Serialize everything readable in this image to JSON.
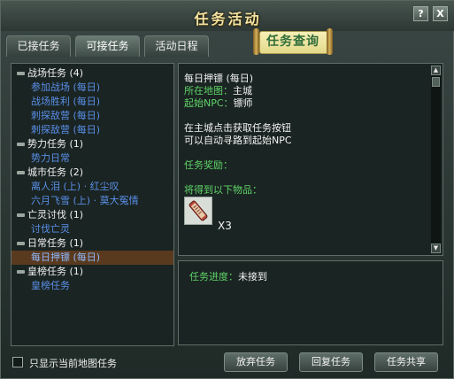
{
  "window": {
    "title": "任务活动",
    "help_label": "?",
    "close_label": "X"
  },
  "tabs": [
    {
      "label": "已接任务"
    },
    {
      "label": "可接任务"
    },
    {
      "label": "活动日程"
    }
  ],
  "badge": {
    "label": "任务查询"
  },
  "quest_list": [
    {
      "kind": "category",
      "label": "战场任务 (4)"
    },
    {
      "kind": "quest",
      "label": "参加战场 (每日)"
    },
    {
      "kind": "quest",
      "label": "战场胜利 (每日)"
    },
    {
      "kind": "quest",
      "label": "刺探敌营 (每日)"
    },
    {
      "kind": "quest",
      "label": "刺探敌营 (每日)"
    },
    {
      "kind": "category",
      "label": "势力任务 (1)"
    },
    {
      "kind": "quest",
      "label": "势力日常"
    },
    {
      "kind": "category",
      "label": "城市任务 (2)"
    },
    {
      "kind": "quest",
      "label": "离人泪 (上) · 红尘叹"
    },
    {
      "kind": "quest",
      "label": "六月飞雪 (上) · 莫大冤情"
    },
    {
      "kind": "category",
      "label": "亡灵讨伐 (1)"
    },
    {
      "kind": "quest",
      "label": "讨伐亡灵"
    },
    {
      "kind": "category",
      "label": "日常任务 (1)"
    },
    {
      "kind": "quest",
      "label": "每日押镖 (每日)",
      "selected": true
    },
    {
      "kind": "category",
      "label": "皇榜任务 (1)"
    },
    {
      "kind": "quest",
      "label": "皇榜任务"
    }
  ],
  "detail": {
    "quest_name": "每日押镖 (每日)",
    "map_label": "所在地图：",
    "map_value": "主城",
    "npc_label": "起始NPC：",
    "npc_value": "镖师",
    "desc_line1": "在主城点击获取任务按钮",
    "desc_line2": "可以自动寻路到起始NPC",
    "reward_label": "任务奖励：",
    "items_label": "将得到以下物品：",
    "item_count": "X3"
  },
  "progress": {
    "label": "任务进度：",
    "value": "未接到"
  },
  "footer": {
    "checkbox_label": "只显示当前地图任务",
    "abandon_label": "放弃任务",
    "reply_label": "回复任务",
    "share_label": "任务共享"
  },
  "colors": {
    "quest_blue": "#5a8fe8",
    "label_green": "#5fd468",
    "title_gold": "#f3e3a2",
    "selected_bg": "#5a3a1f"
  }
}
